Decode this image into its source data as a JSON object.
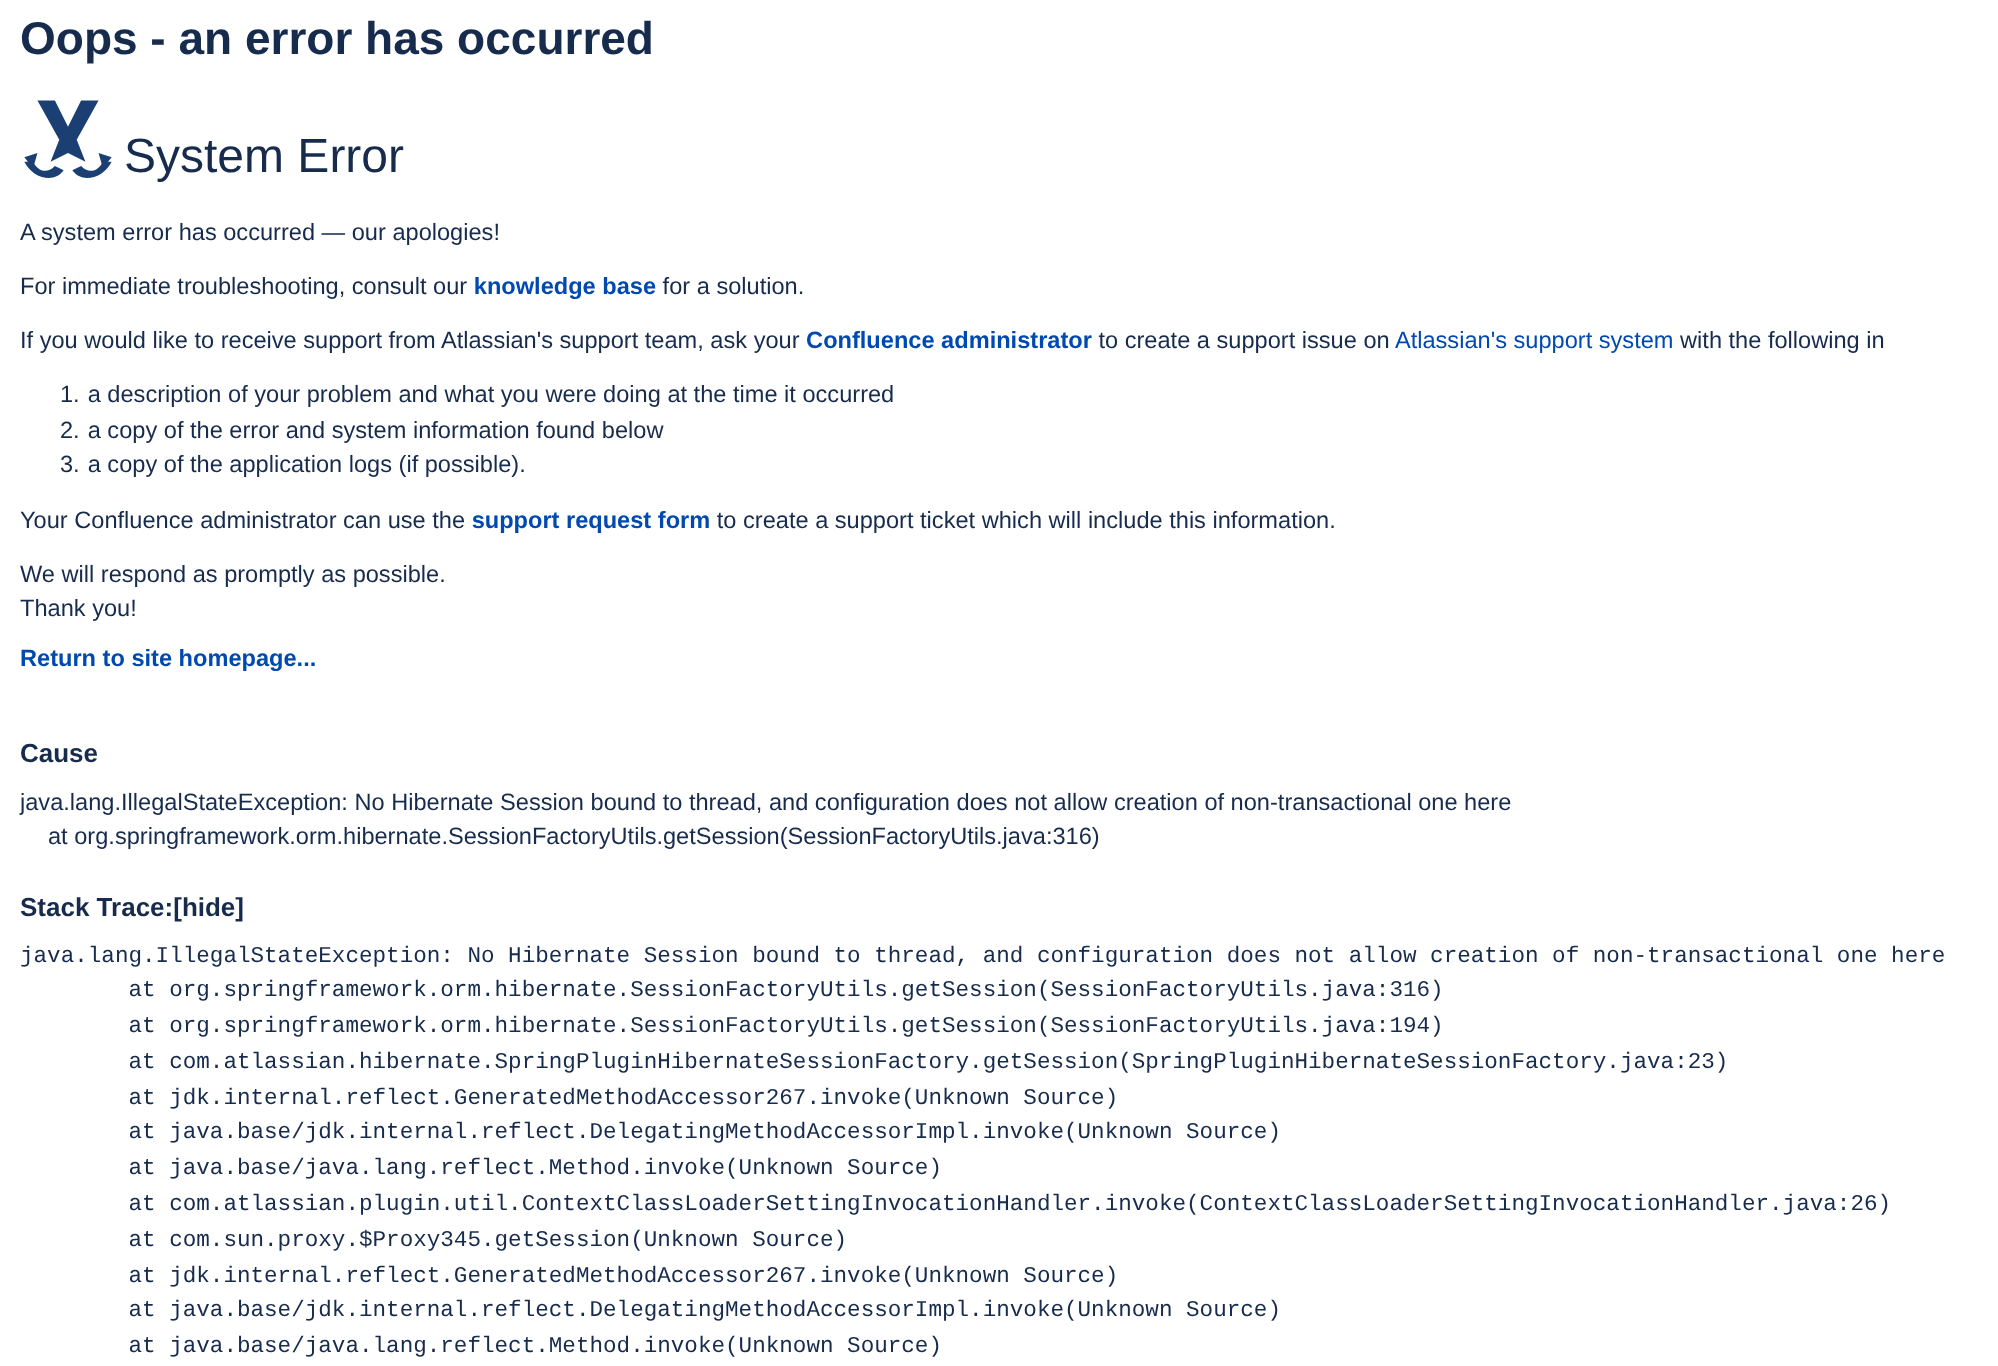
{
  "page_title": "Oops - an error has occurred",
  "heading": "System Error",
  "paragraphs": [
    [
      {
        "text": "A system error has occurred — our apologies!"
      }
    ],
    [
      {
        "text": "For immediate troubleshooting, consult our "
      },
      {
        "text": "knowledge base",
        "kind": "link",
        "bold": true
      },
      {
        "text": " for a solution."
      }
    ],
    [
      {
        "text": "If you would like to receive support from Atlassian's support team, ask your "
      },
      {
        "text": "Confluence administrator",
        "kind": "link",
        "bold": true
      },
      {
        "text": " to create a support issue on "
      },
      {
        "text": "Atlassian's support system",
        "kind": "link",
        "bold": false
      },
      {
        "text": " with the following in"
      }
    ]
  ],
  "list": [
    {
      "marker": "1.",
      "text": "a description of your problem and what you were doing at the time it occurred"
    },
    {
      "marker": "2.",
      "text": "a copy of the error and system information found below"
    },
    {
      "marker": "3.",
      "text": "a copy of the application logs (if possible)."
    }
  ],
  "admin_paragraph": [
    {
      "text": "Your Confluence administrator can use the "
    },
    {
      "text": "support request form",
      "kind": "link",
      "bold": true
    },
    {
      "text": " to create a support ticket which will include this information."
    }
  ],
  "closing": [
    "We will respond as promptly as possible.",
    "Thank you!"
  ],
  "return_link": "Return to site homepage...",
  "cause": {
    "title": "Cause",
    "lines": [
      "java.lang.IllegalStateException: No Hibernate Session bound to thread, and configuration does not allow creation of non-transactional one here",
      "at org.springframework.orm.hibernate.SessionFactoryUtils.getSession(SessionFactoryUtils.java:316)"
    ]
  },
  "stack_trace": {
    "title": "Stack Trace:",
    "toggle": "[hide]",
    "lines": [
      "java.lang.IllegalStateException: No Hibernate Session bound to thread, and configuration does not allow creation of non-transactional one here",
      "        at org.springframework.orm.hibernate.SessionFactoryUtils.getSession(SessionFactoryUtils.java:316)",
      "        at org.springframework.orm.hibernate.SessionFactoryUtils.getSession(SessionFactoryUtils.java:194)",
      "        at com.atlassian.hibernate.SpringPluginHibernateSessionFactory.getSession(SpringPluginHibernateSessionFactory.java:23)",
      "        at jdk.internal.reflect.GeneratedMethodAccessor267.invoke(Unknown Source)",
      "        at java.base/jdk.internal.reflect.DelegatingMethodAccessorImpl.invoke(Unknown Source)",
      "        at java.base/java.lang.reflect.Method.invoke(Unknown Source)",
      "        at com.atlassian.plugin.util.ContextClassLoaderSettingInvocationHandler.invoke(ContextClassLoaderSettingInvocationHandler.java:26)",
      "        at com.sun.proxy.$Proxy345.getSession(Unknown Source)",
      "        at jdk.internal.reflect.GeneratedMethodAccessor267.invoke(Unknown Source)",
      "        at java.base/jdk.internal.reflect.DelegatingMethodAccessorImpl.invoke(Unknown Source)",
      "        at java.base/java.lang.reflect.Method.invoke(Unknown Source)"
    ]
  }
}
